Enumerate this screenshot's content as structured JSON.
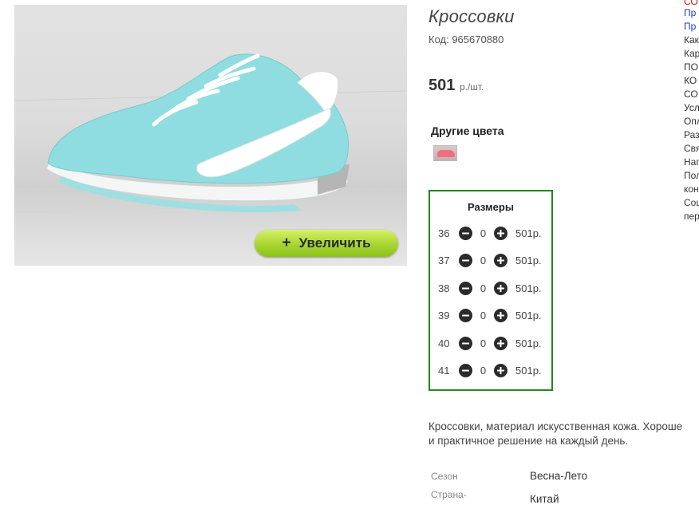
{
  "product": {
    "title": "Кроссовки",
    "code": "Код: 965670880",
    "price": "501",
    "price_unit": "р./шт.",
    "zoom_label": "Увеличить",
    "zoom_plus": "+"
  },
  "other_colors": {
    "title": "Другие цвета"
  },
  "sizes": {
    "title": "Размеры",
    "rows": [
      {
        "size": "36",
        "qty": "0",
        "price": "501р."
      },
      {
        "size": "37",
        "qty": "0",
        "price": "501р."
      },
      {
        "size": "38",
        "qty": "0",
        "price": "501р."
      },
      {
        "size": "39",
        "qty": "0",
        "price": "501р."
      },
      {
        "size": "40",
        "qty": "0",
        "price": "501р."
      },
      {
        "size": "41",
        "qty": "0",
        "price": "501р."
      }
    ]
  },
  "description": {
    "line1": "Кроссовки, материал искусственная кожа. Хороше",
    "line2": "и практичное решение на каждый день."
  },
  "attributes": [
    {
      "label": "Сезон",
      "value": "Весна-Лето"
    },
    {
      "label": "Страна-",
      "value": "Китай"
    }
  ],
  "side_links": [
    "СО",
    "Пр",
    "Пр",
    "Как",
    "Кар",
    "ПО",
    "КО",
    "СО",
    "Усл",
    "Опл",
    "Раз",
    "Свя",
    "Нап",
    "Пол",
    "кон",
    "Соц",
    "пер"
  ],
  "colors": {
    "sizes_border": "#1f8a1f",
    "zoom_button": "#a7d530",
    "sneaker": "#8fdde0"
  }
}
